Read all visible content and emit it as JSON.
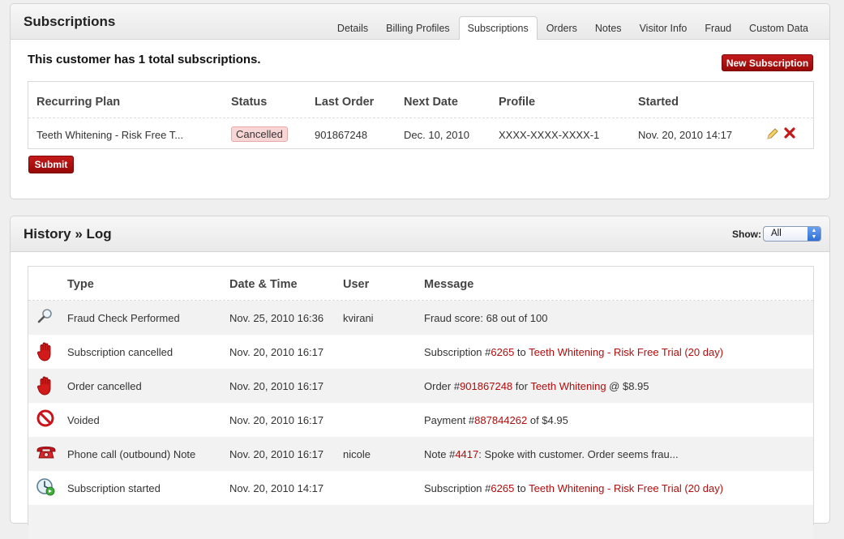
{
  "subscriptions": {
    "title": "Subscriptions",
    "tabs": [
      "Details",
      "Billing Profiles",
      "Subscriptions",
      "Orders",
      "Notes",
      "Visitor Info",
      "Fraud",
      "Custom Data"
    ],
    "active_tab": "Subscriptions",
    "summary": "This customer has 1 total subscriptions.",
    "new_button": "New Subscription",
    "submit_button": "Submit",
    "columns": [
      "Recurring Plan",
      "Status",
      "Last Order",
      "Next Date",
      "Profile",
      "Started"
    ],
    "row": {
      "plan": "Teeth Whitening - Risk Free T...",
      "status": "Cancelled",
      "last_order": "901867248",
      "next_date": "Dec. 10, 2010",
      "profile": "XXXX-XXXX-XXXX-1",
      "started": "Nov. 20, 2010 14:17"
    }
  },
  "history": {
    "title": "History",
    "separator": "»",
    "subtitle": "Log",
    "show_label": "Show:",
    "show_value": "All",
    "columns": [
      "Type",
      "Date & Time",
      "User",
      "Message"
    ],
    "rows": [
      {
        "icon": "magnifier-icon",
        "type": "Fraud Check Performed",
        "date": "Nov. 25, 2010 16:36",
        "user": "kvirani",
        "message": "Fraud score: 68 out of 100"
      },
      {
        "icon": "red-hand-stop-icon",
        "type": "Subscription cancelled",
        "date": "Nov. 20, 2010 16:17",
        "user": "",
        "message_parts": [
          "Subscription ",
          "#",
          "6265",
          " to ",
          "Teeth Whitening - Risk Free Trial (20 day)"
        ]
      },
      {
        "icon": "red-hand-stop-icon",
        "type": "Order cancelled",
        "date": "Nov. 20, 2010 16:17",
        "user": "",
        "message_parts": [
          "Order #",
          "901867248",
          " for ",
          "Teeth Whitening",
          " @ $8.95"
        ]
      },
      {
        "icon": "no-entry-icon",
        "type": "Voided",
        "date": "Nov. 20, 2010 16:17",
        "user": "",
        "message_parts": [
          "Payment #",
          "887844262",
          " of $4.95"
        ]
      },
      {
        "icon": "telephone-icon",
        "type": "Phone call (outbound) Note",
        "date": "Nov. 20, 2010 16:17",
        "user": "nicole",
        "message_parts": [
          "Note #",
          "4417",
          ": Spoke with customer. Order seems frau..."
        ]
      },
      {
        "icon": "clock-start-icon",
        "type": "Subscription started",
        "date": "Nov. 20, 2010 14:17",
        "user": "",
        "message_parts": [
          "Subscription ",
          "#",
          "6265",
          " to ",
          "Teeth Whitening - Risk Free Trial (20 day)"
        ]
      }
    ]
  },
  "colors": {
    "accent": "#b00d0d",
    "button_red": "#a80f0f",
    "badge_bg": "#f9d6d6",
    "row_alt": "#f2f2f2"
  }
}
